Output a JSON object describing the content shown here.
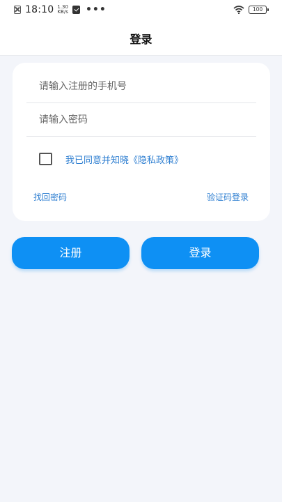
{
  "status_bar": {
    "time": "18:10",
    "net_speed_value": "1.30",
    "net_speed_unit": "KB/s",
    "dots": "•••",
    "battery": "100",
    "icons": [
      "close-box-icon",
      "check-shield-icon",
      "wifi-icon",
      "battery-icon"
    ]
  },
  "header": {
    "title": "登录"
  },
  "form": {
    "phone_placeholder": "请输入注册的手机号",
    "password_placeholder": "请输入密码",
    "agree_text": "我已同意并知晓",
    "agree_policy": "《隐私政策》",
    "agree_checked": false,
    "forgot_password": "找回密码",
    "sms_login": "验证码登录"
  },
  "buttons": {
    "register": "注册",
    "login": "登录"
  },
  "colors": {
    "accent": "#0e90f4",
    "link": "#2f7fd1",
    "background": "#f3f5fa"
  }
}
